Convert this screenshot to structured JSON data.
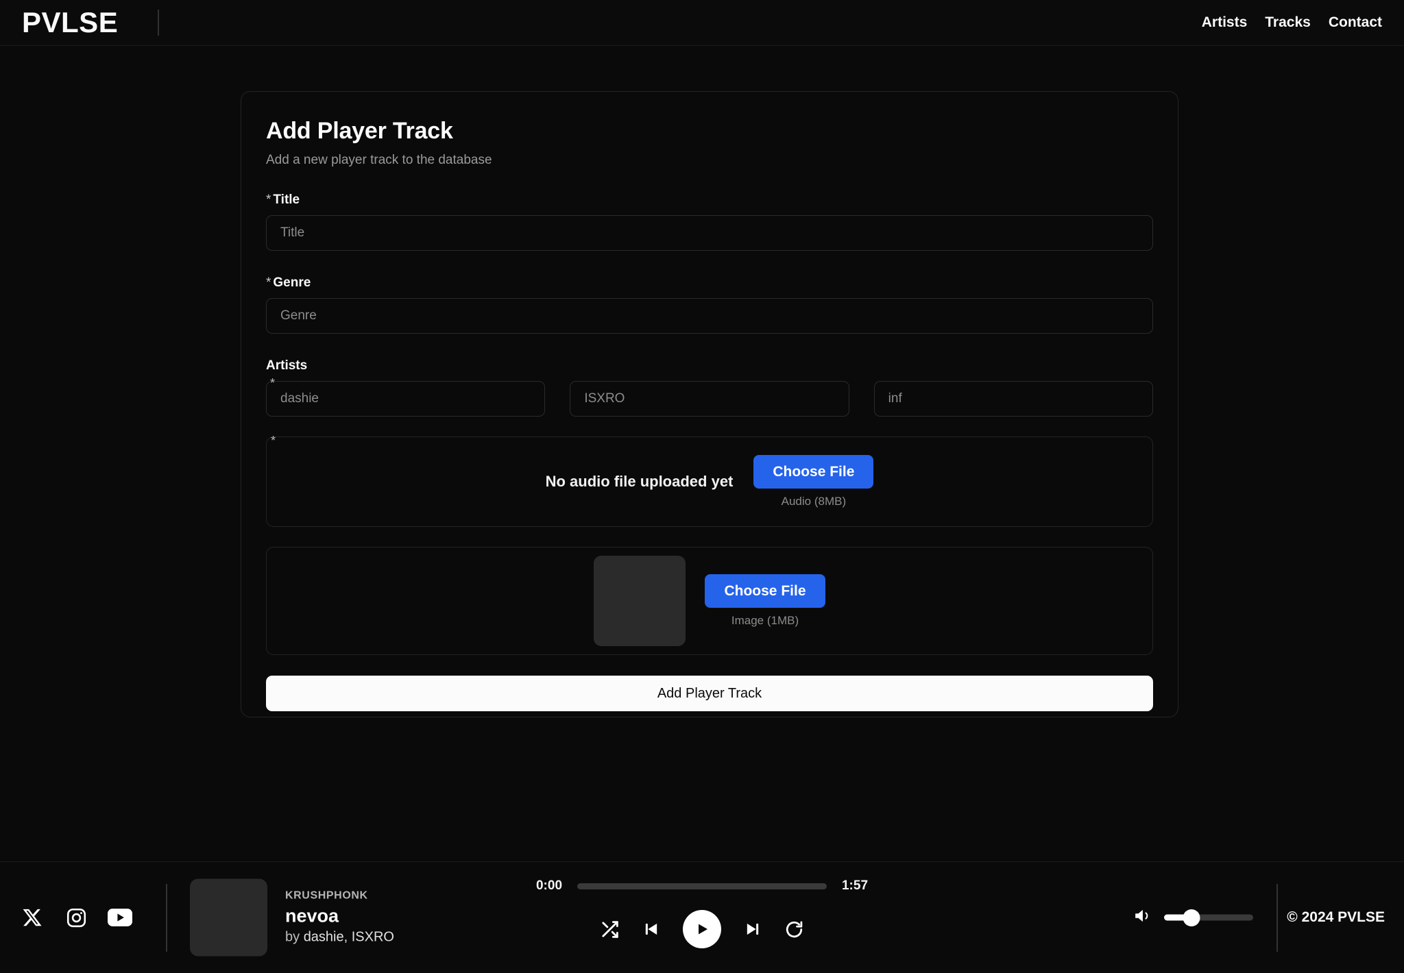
{
  "header": {
    "logo": "PVLSE",
    "nav": [
      {
        "label": "Artists"
      },
      {
        "label": "Tracks"
      },
      {
        "label": "Contact"
      }
    ]
  },
  "form_card": {
    "title": "Add Player Track",
    "subtitle": "Add a new player track to the database",
    "required_marker": "*",
    "fields": {
      "title": {
        "label": "Title",
        "required": true,
        "placeholder": "Title",
        "value": ""
      },
      "genre": {
        "label": "Genre",
        "required": true,
        "placeholder": "Genre",
        "value": ""
      }
    },
    "artists": {
      "label": "Artists",
      "inputs": [
        {
          "placeholder": "dashie",
          "value": "",
          "required": true
        },
        {
          "placeholder": "ISXRO",
          "value": "",
          "required": false
        },
        {
          "placeholder": "inf",
          "value": "",
          "required": false
        }
      ]
    },
    "audio_upload": {
      "required": true,
      "status_text": "No audio file uploaded yet",
      "button_label": "Choose File",
      "hint": "Audio (8MB)"
    },
    "image_upload": {
      "required": false,
      "button_label": "Choose File",
      "hint": "Image (1MB)",
      "thumbnail_placeholder": true
    },
    "submit_label": "Add Player Track"
  },
  "player": {
    "socials": [
      {
        "icon": "x-twitter-icon",
        "name": "X"
      },
      {
        "icon": "instagram-icon",
        "name": "Instagram"
      },
      {
        "icon": "youtube-icon",
        "name": "YouTube"
      }
    ],
    "now_playing": {
      "album": "KRUSHPHONK",
      "title": "nevoa",
      "artists_prefix": "by ",
      "artists": "dashie, ISXRO"
    },
    "progress": {
      "current_time": "0:00",
      "total_time": "1:57",
      "percent": 0
    },
    "controls": {
      "shuffle": "shuffle-icon",
      "previous": "previous-track-icon",
      "play": "play-icon",
      "next": "next-track-icon",
      "repeat": "repeat-icon"
    },
    "volume": {
      "icon": "volume-icon",
      "percent": 31
    },
    "copyright": "© 2024 PVLSE"
  },
  "colors": {
    "background": "#0a0a0a",
    "accent_blue": "#2563eb",
    "submit_bg": "#fbfbfb",
    "border": "#242424",
    "muted_text": "#8c8c8c"
  }
}
